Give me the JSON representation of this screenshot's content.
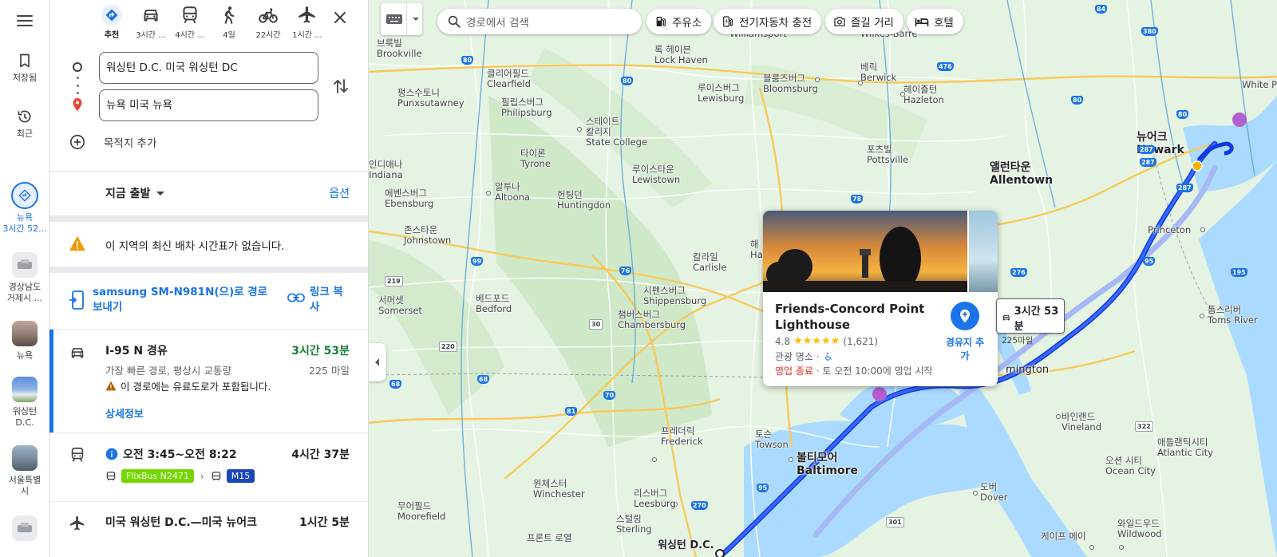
{
  "rail": {
    "saved_label": "저장됨",
    "recent_label": "최근",
    "active_label": "뉴욕\n3시간 52...",
    "active_label_line1": "뉴욕",
    "active_label_line2": "3시간 52...",
    "items": [
      {
        "line1": "경상남도",
        "line2": "거제시 ..."
      },
      {
        "line1": "뉴욕",
        "line2": ""
      },
      {
        "line1": "워싱턴",
        "line2": "D.C."
      },
      {
        "line1": "서울특별",
        "line2": "시"
      }
    ]
  },
  "modes": [
    {
      "name": "recommended",
      "label": "추천",
      "icon": "directions-icon",
      "active": true
    },
    {
      "name": "car",
      "label": "3시간 ...",
      "icon": "car-icon",
      "active": false
    },
    {
      "name": "transit",
      "label": "4시간 ...",
      "icon": "train-icon",
      "active": false
    },
    {
      "name": "walk",
      "label": "4일",
      "icon": "walk-icon",
      "active": false
    },
    {
      "name": "bike",
      "label": "22시간",
      "icon": "bike-icon",
      "active": false
    },
    {
      "name": "flight",
      "label": "1시간 ...",
      "icon": "flight-icon",
      "active": false
    }
  ],
  "route": {
    "origin": "워싱턴 D.C. 미국 워싱턴 DC",
    "destination": "뉴욕 미국 뉴욕",
    "add_destination": "목적지 추가"
  },
  "depart": {
    "label": "지금 출발",
    "options": "옵션"
  },
  "alert": "이 지역의 최신 배차 시간표가 없습니다.",
  "send": {
    "label": "samsung SM-N981N(으)로 경로 보내기",
    "copy": "링크 복사"
  },
  "routes": {
    "car": {
      "title": "I-95 N 경유",
      "time": "3시간 53분",
      "sub": "가장 빠른 경로, 평상시 교통량",
      "dist": "225 마일",
      "warning": "이 경로에는 유료도로가 포함됩니다.",
      "details": "상세정보"
    },
    "transit": {
      "title": "오전 3:45~오전 8:22",
      "time": "4시간 37분",
      "bus1": "FlixBus N2471",
      "bus2": "M15"
    },
    "flight": {
      "title": "미국 워싱턴 D.C.—미국 뉴어크",
      "time": "1시간 5분"
    }
  },
  "map": {
    "search_placeholder": "경로에서 검색",
    "chips": [
      "주유소",
      "전기자동차 충전",
      "즐길 거리",
      "호텔"
    ],
    "labels": {
      "brookville": "브룩빌\nBrookville",
      "clearfield": "클리어필드\nClearfield",
      "lockhaven": "록 헤이븐\nLock Haven",
      "berwick": "베릭\nBerwick",
      "punxsutawney": "펑스수토니\nPunxsutawney",
      "philipsburg": "필립스버그\nPhilipsburg",
      "lewisburg": "루이스버그\nLewisburg",
      "bloomsburg": "블룸즈버그\nBloomsburg",
      "hazleton": "헤이즐턴\nHazleton",
      "statecollege": "스테이트\n칼리지\nState College",
      "tyrone": "타이론\nTyrone",
      "pottsville": "포츠빌\nPottsville",
      "allentown": "앨런타운\nAllentown",
      "newark": "뉴어크\nNewark",
      "indiana": "인디애나\nIndiana",
      "lewistown": "루이스타운\nLewistown",
      "ebensburg": "에벤스버그\nEbensburg",
      "altoona": "알투나\nAltoona",
      "huntingdon": "헌팅던\nHuntingdon",
      "johnstown": "존스타운\nJohnstown",
      "princeton": "Princeton",
      "carlisle": "칼라일\nCarlisle",
      "shippensburg": "시펜스버그\nShippensburg",
      "chambersburg": "챔버스버그\nChambersburg",
      "somerset": "서머셋\nSomerset",
      "bedford": "베드포드\nBedford",
      "tomsriver": "톰스리버\nToms River",
      "wilmington": "mington",
      "frederick": "프레더릭\nFrederick",
      "towson": "토슨\nTowson",
      "baltimore": "볼티모어\nBaltimore",
      "vineland": "바인랜드\nVineland",
      "atlanticcity": "애틀랜틱시티\nAtlantic City",
      "oceancity": "오션 시티\nOcean City",
      "winchester": "윈체스터\nWinchester",
      "leesburg": "리스버그\nLeesburg",
      "dover": "도버\nDover",
      "moorefield": "무어필드\nMoorefield",
      "sterling": "스털링\nSterling",
      "frontroyal": "프론트 로열",
      "capemay": "케이프 메이",
      "wildwood": "와일드우드\nWildwood",
      "washington": "워싱턴 D.C.",
      "whiteplains": "White P",
      "wilkesbarre": "Wilkes-Barre",
      "williamsport": "Williamsport",
      "harrisburg": "해\nHa"
    }
  },
  "place": {
    "title": "Friends-Concord Point Lighthouse",
    "rating": "4.8",
    "stars": "★★★★★",
    "count": "(1,621)",
    "category": "관광 명소 ·",
    "closed": "영업 종료",
    "opens": " · 토 오전 10:00에 영업 시작",
    "add_stop": "경유지 추가"
  },
  "callout": {
    "time": "3시간 53분",
    "dist": "225마일"
  },
  "colors": {
    "accent": "#1a73e8",
    "route": "#1a3ff0",
    "flixbus": "#73d700",
    "m15": "#1a47b8",
    "warning": "#f29900",
    "closed": "#d93025"
  }
}
